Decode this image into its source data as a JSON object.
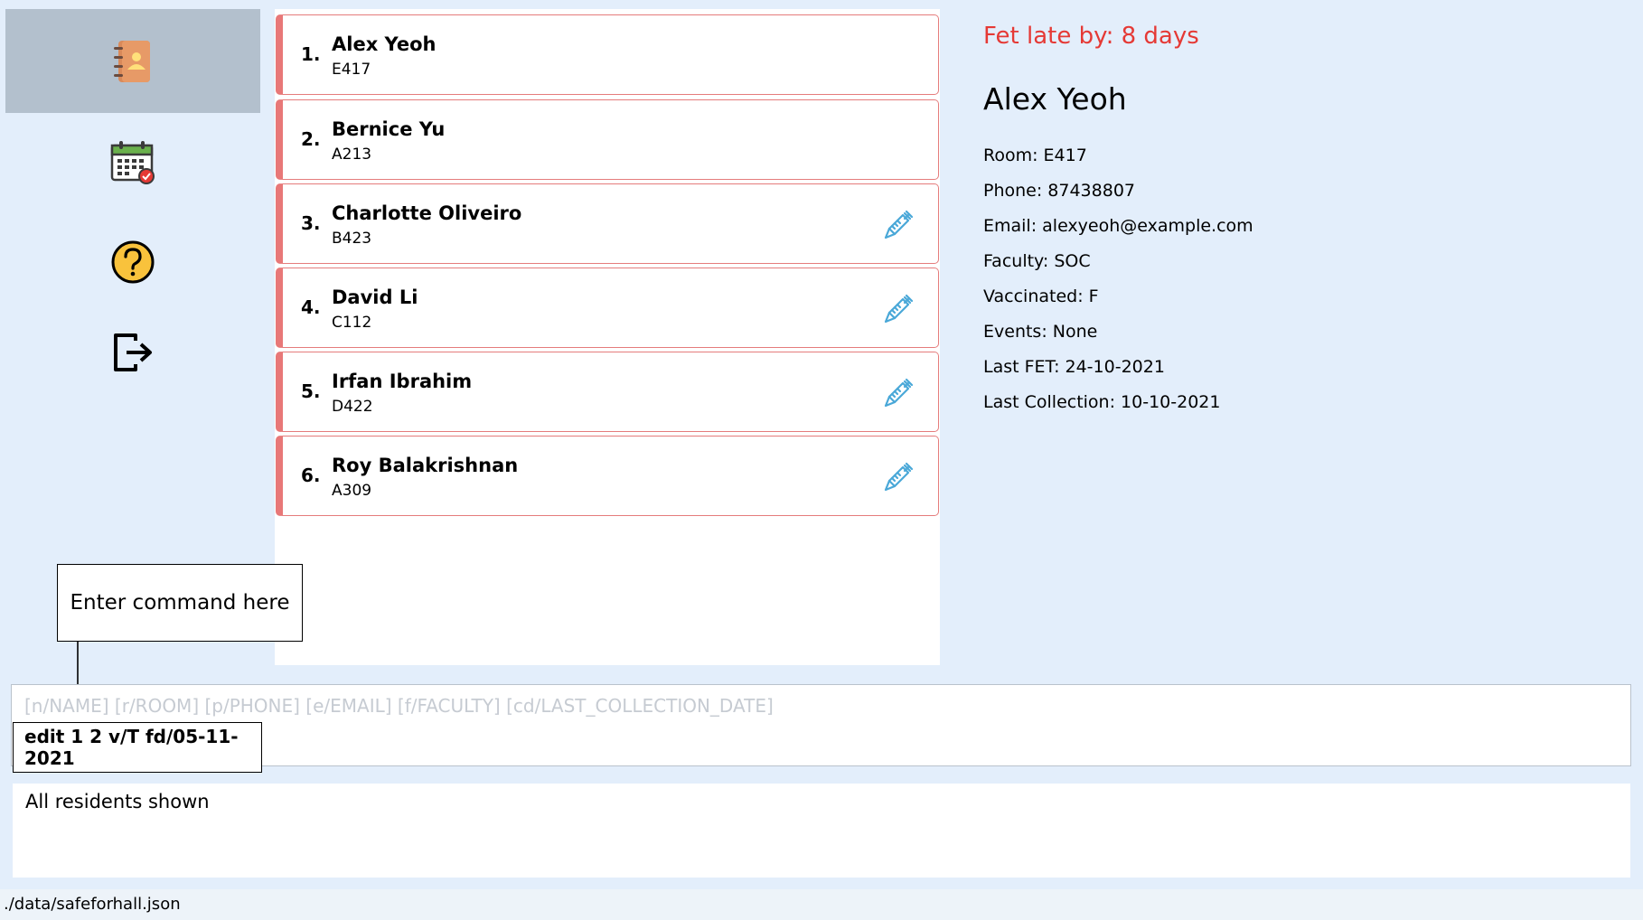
{
  "sidebar": {
    "items": [
      {
        "icon": "address-book-icon"
      },
      {
        "icon": "calendar-icon"
      },
      {
        "icon": "help-icon"
      },
      {
        "icon": "logout-icon"
      }
    ]
  },
  "residents": [
    {
      "index": "1.",
      "name": "Alex Yeoh",
      "room": "E417",
      "vaccinated": false
    },
    {
      "index": "2.",
      "name": "Bernice Yu",
      "room": "A213",
      "vaccinated": false
    },
    {
      "index": "3.",
      "name": "Charlotte Oliveiro",
      "room": "B423",
      "vaccinated": true
    },
    {
      "index": "4.",
      "name": "David Li",
      "room": "C112",
      "vaccinated": true
    },
    {
      "index": "5.",
      "name": "Irfan Ibrahim",
      "room": "D422",
      "vaccinated": true
    },
    {
      "index": "6.",
      "name": "Roy Balakrishnan",
      "room": "A309",
      "vaccinated": true
    }
  ],
  "details": {
    "fet_late": "Fet late by: 8 days",
    "name": "Alex Yeoh",
    "room": "Room: E417",
    "phone": "Phone: 87438807",
    "email": "Email: alexyeoh@example.com",
    "faculty": "Faculty: SOC",
    "vaccinated": "Vaccinated: F",
    "events": "Events: None",
    "last_fet": "Last FET: 24-10-2021",
    "last_collection": "Last Collection: 10-10-2021"
  },
  "tooltip": {
    "text": "Enter command here"
  },
  "command": {
    "placeholder": "[n/NAME] [r/ROOM] [p/PHONE] [e/EMAIL] [f/FACULTY] [cd/LAST_COLLECTION_DATE]",
    "value": "",
    "example": "edit 1 2 v/T fd/05-11-2021"
  },
  "result": {
    "text": "All residents shown"
  },
  "status_bar": {
    "path": "./data/safeforhall.json"
  },
  "colors": {
    "accent_red": "#e53935",
    "card_border": "#e87878",
    "sidebar_active": "#b3c0cd",
    "background": "#e3eefb",
    "vaccine_icon": "#4aa8d8"
  }
}
